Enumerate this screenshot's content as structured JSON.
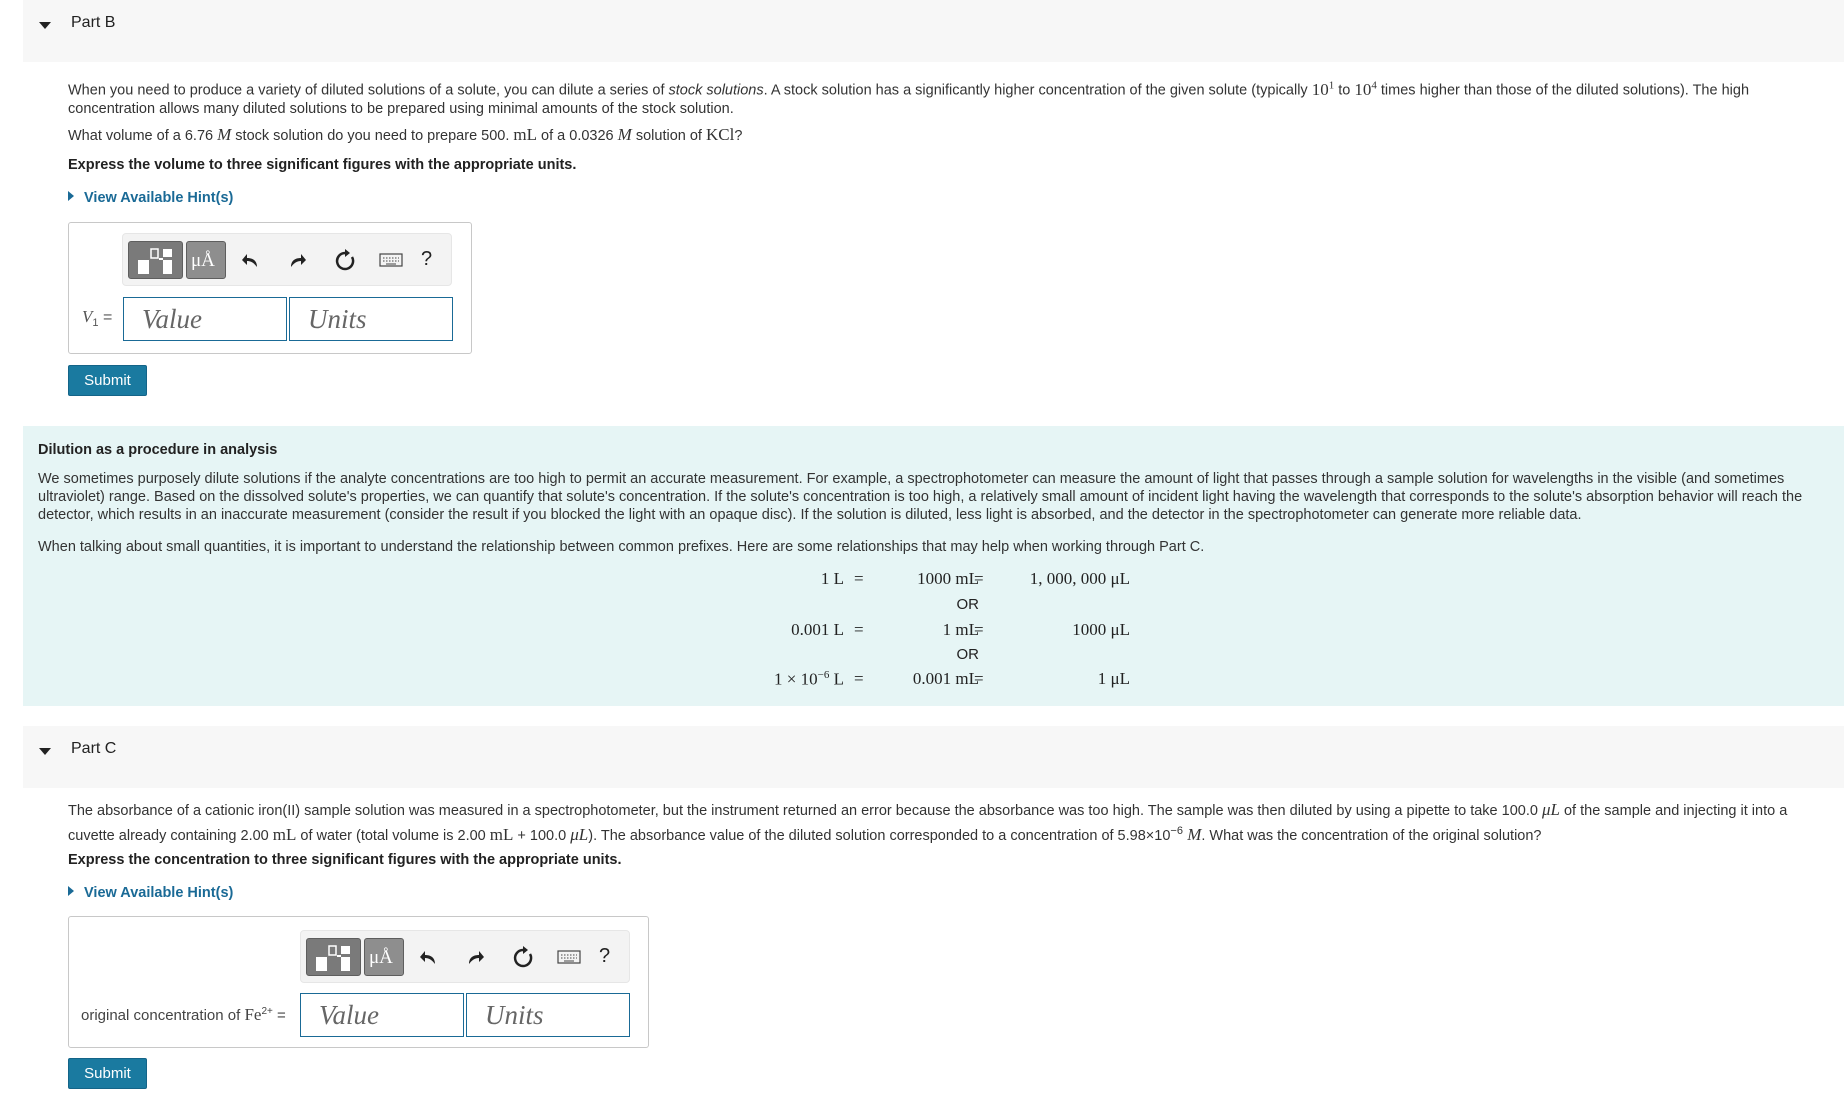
{
  "partB": {
    "header": "Part B",
    "intro_1": "When you need to produce a variety of diluted solutions of a solute, you can dilute a series of ",
    "intro_em": "stock solutions",
    "intro_2": ". A stock solution has a significantly higher concentration of the given solute (typically ",
    "intro_p1": "10",
    "intro_p1_exp": "1",
    "intro_to": " to ",
    "intro_p2": "10",
    "intro_p2_exp": "4",
    "intro_3": " times higher than those of the diluted solutions). The high",
    "intro_line2": "concentration allows many diluted solutions to be prepared using minimal amounts of the stock solution.",
    "q_1": "What volume of a 6.76 ",
    "q_M1": "M",
    "q_2": " stock solution do you need to prepare 500. ",
    "q_mL": "mL",
    "q_3": " of a 0.0326 ",
    "q_M2": "M",
    "q_4": " solution of ",
    "q_KCl": "KCl",
    "q_5": "?",
    "instruction": "Express the volume to three significant figures with the appropriate units.",
    "hint": "View Available Hint(s)",
    "label_var": "V",
    "label_sub": "1",
    "label_eq": " =",
    "value_placeholder": "Value",
    "units_placeholder": "Units",
    "submit": "Submit"
  },
  "toolbar": {
    "mu_label": "μÅ",
    "help": "?"
  },
  "info": {
    "title": "Dilution as a procedure in analysis",
    "p1_l1": "We sometimes purposely dilute solutions if the analyte concentrations are too high to permit an accurate measurement. For example, a spectrophotometer can measure the amount of light that passes through a sample solution for wavelengths in the visible (and sometimes",
    "p1_l2": "ultraviolet) range. Based on the dissolved solute's properties, we can quantify that solute's concentration. If the solute's concentration is too high, a relatively small amount of incident light having the wavelength that corresponds to the solute's absorption behavior will reach the",
    "p1_l3": "detector, which results in an inaccurate measurement (consider the result if you blocked the light with an opaque disc). If the solution is diluted, less light is absorbed, and the detector in the spectrophotometer can generate more reliable data.",
    "p2": "When talking about small quantities, it is important to understand the relationship between common prefixes. Here are some relationships that may help when working through Part C.",
    "r1_a": "1 L",
    "r1_b": "1000 mL",
    "r1_c": "1, 000, 000 μL",
    "or1": "OR",
    "r2_a": "0.001 L",
    "r2_b": "1 mL",
    "r2_c": "1000 μL",
    "or2": "OR",
    "r3_a": "1 × 10",
    "r3_exp": "−6",
    "r3_a2": " L",
    "r3_b": "0.001 mL",
    "r3_c": "1 μL",
    "eq": "="
  },
  "partC": {
    "header": "Part C",
    "l1_a": "The absorbance of a cationic iron(II) sample solution was measured in a spectrophotometer, but the instrument returned an error because the absorbance was too high. The sample was then diluted by using a pipette to take 100.0 ",
    "l1_uL": "μL",
    "l1_b": " of the sample and injecting it into a",
    "l2_a": "cuvette already containing 2.00 ",
    "l2_mL": "mL",
    "l2_b": " of water (total volume is 2.00 ",
    "l2_mL2": "mL",
    "l2_c": " + 100.0 ",
    "l2_uL": "μL",
    "l2_d": "). The absorbance value of the diluted solution corresponded to a concentration of 5.98×10",
    "l2_exp": "−6",
    "l2_M": " M",
    "l2_e": ". What was the concentration of the original solution?",
    "instruction": "Express the concentration to three significant figures with the appropriate units.",
    "hint": "View Available Hint(s)",
    "label_text": "original concentration of ",
    "label_fe": "Fe",
    "label_sup": "2+",
    "label_eq": " =",
    "value_placeholder": "Value",
    "units_placeholder": "Units",
    "submit": "Submit"
  }
}
